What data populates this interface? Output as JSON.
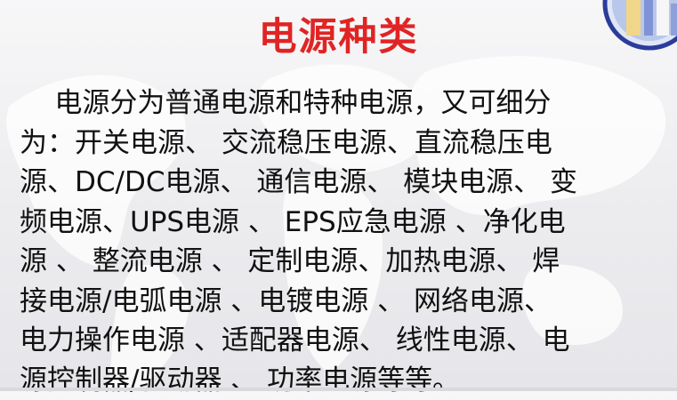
{
  "slide": {
    "title": "电源种类",
    "lines": [
      "    电源分为普通电源和特种电源，又可细分",
      "为：开关电源、 交流稳压电源、直流稳压电",
      "源、DC/DC电源、 通信电源、 模块电源、 变",
      "频电源、UPS电源 、 EPS应急电源 、净化电",
      "源 、 整流电源 、 定制电源、加热电源、 焊",
      "接电源/电弧电源 、电镀电源 、 网络电源、",
      "电力操作电源 、适配器电源、 线性电源、 电",
      "源控制器/驱动器 、 功率电源等等。"
    ]
  },
  "colors": {
    "title": "#e02424",
    "text": "#111111",
    "logo_ring": "#2b3c9a"
  }
}
